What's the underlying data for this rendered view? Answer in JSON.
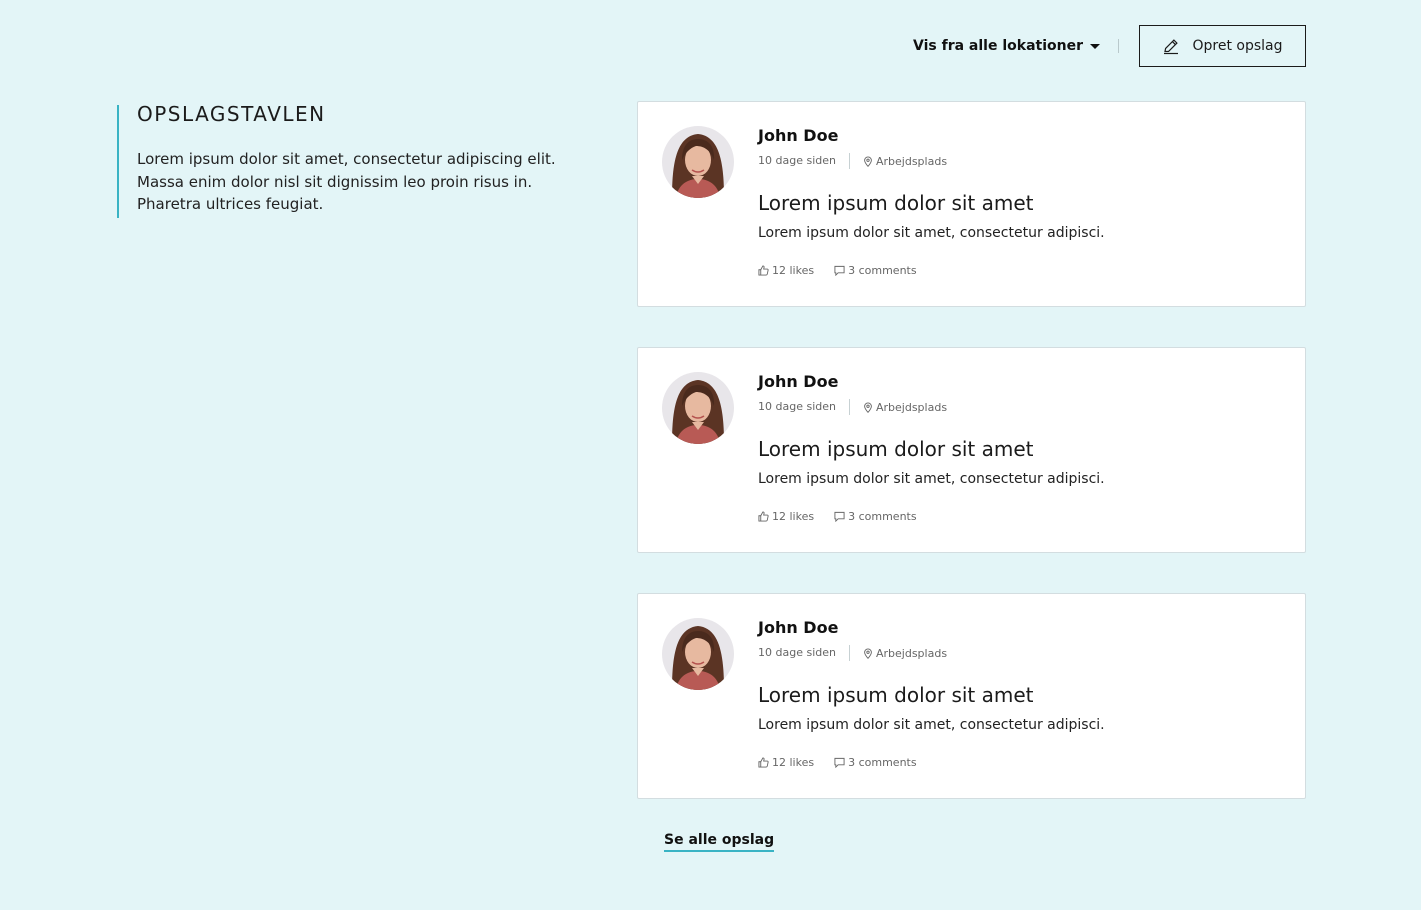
{
  "toolbar": {
    "location_filter_label": "Vis fra alle lokationer",
    "create_post_label": "Opret opslag"
  },
  "intro": {
    "title": "OPSLAGSTAVLEN",
    "description": "Lorem ipsum dolor sit amet, consectetur adipiscing elit. Massa enim dolor nisl sit dignissim leo proin risus in. Pharetra ultrices feugiat."
  },
  "posts": [
    {
      "author": "John Doe",
      "time": "10 dage siden",
      "location": "Arbejdsplads",
      "title": "Lorem ipsum dolor sit amet",
      "text": "Lorem ipsum dolor sit amet, consectetur adipisci.",
      "likes": "12 likes",
      "comments": "3 comments"
    },
    {
      "author": "John Doe",
      "time": "10 dage siden",
      "location": "Arbejdsplads",
      "title": "Lorem ipsum dolor sit amet",
      "text": "Lorem ipsum dolor sit amet, consectetur adipisci.",
      "likes": "12 likes",
      "comments": "3 comments"
    },
    {
      "author": "John Doe",
      "time": "10 dage siden",
      "location": "Arbejdsplads",
      "title": "Lorem ipsum dolor sit amet",
      "text": "Lorem ipsum dolor sit amet, consectetur adipisci.",
      "likes": "12 likes",
      "comments": "3 comments"
    }
  ],
  "see_all_label": "Se alle opslag",
  "colors": {
    "background": "#e3f5f7",
    "accent": "#39b3c4",
    "card": "#ffffff"
  }
}
